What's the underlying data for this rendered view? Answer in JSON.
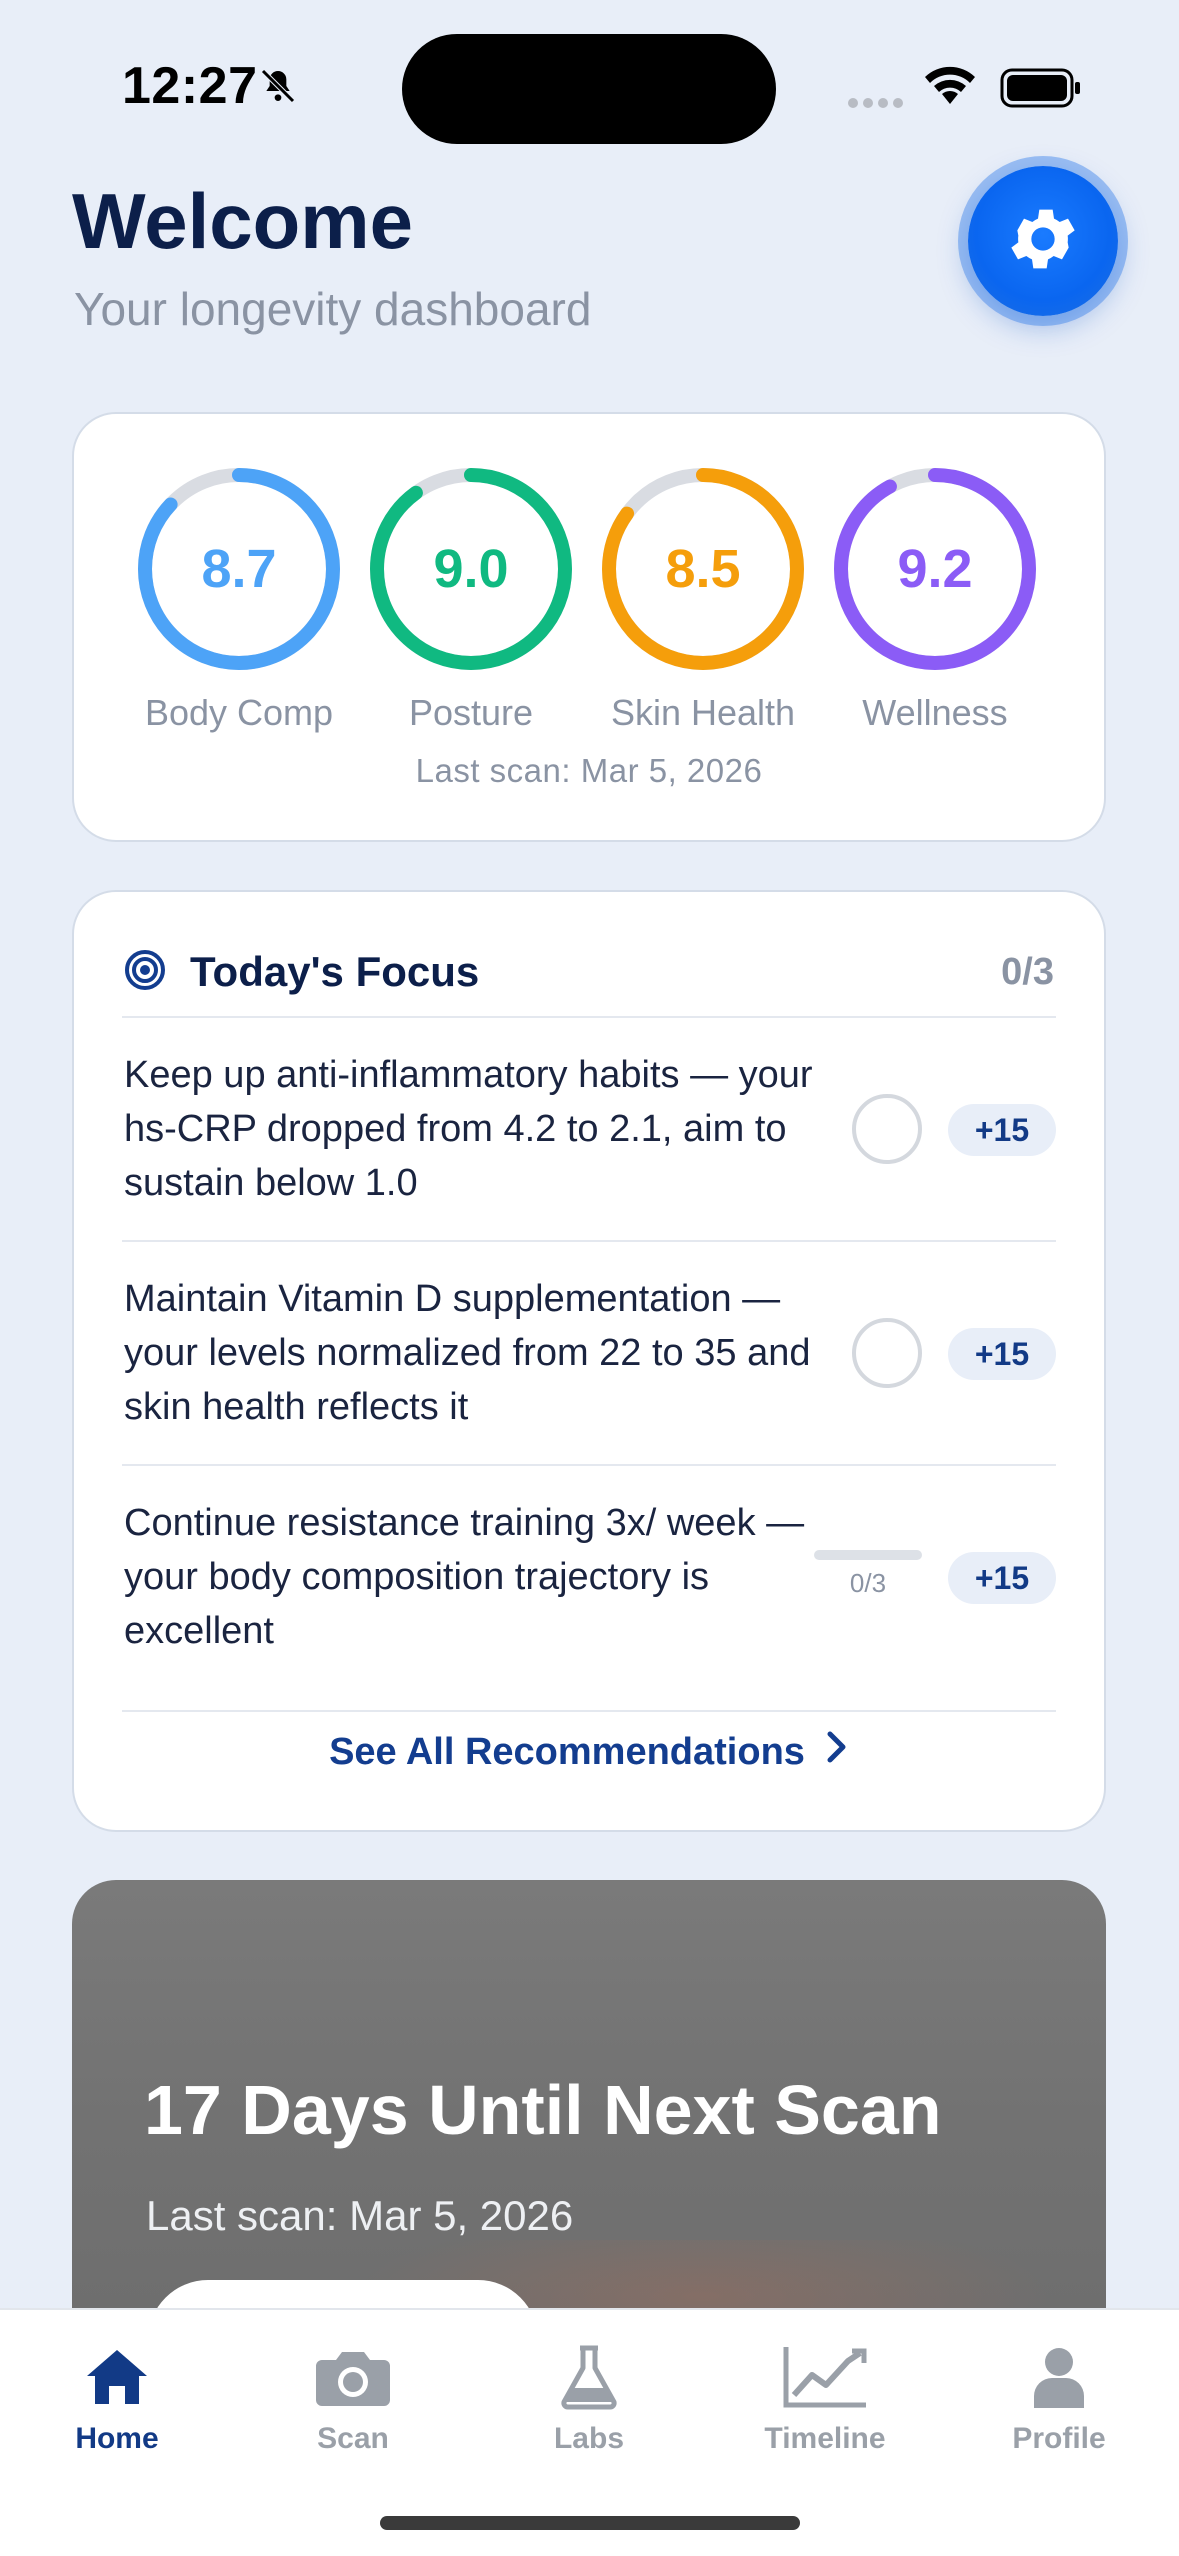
{
  "status_bar": {
    "time": "12:27"
  },
  "header": {
    "title": "Welcome",
    "subtitle": "Your longevity dashboard"
  },
  "scores": {
    "items": [
      {
        "value": "8.7",
        "label": "Body Comp",
        "color": "#4da3f7",
        "fraction": 0.87
      },
      {
        "value": "9.0",
        "label": "Posture",
        "color": "#10b981",
        "fraction": 0.9
      },
      {
        "value": "8.5",
        "label": "Skin Health",
        "color": "#f59e0b",
        "fraction": 0.85
      },
      {
        "value": "9.2",
        "label": "Wellness",
        "color": "#8b5cf6",
        "fraction": 0.92
      }
    ],
    "last_scan": "Last scan: Mar 5, 2026"
  },
  "focus": {
    "title": "Today's Focus",
    "count": "0/3",
    "items": [
      {
        "text": "Keep up anti-inflammatory habits — your hs-CRP dropped from 4.2 to 2.1, aim to sustain below 1.0",
        "points": "+15"
      },
      {
        "text": "Maintain Vitamin D supplementation — your levels normalized from 22 to 35 and skin health reflects it",
        "points": "+15"
      },
      {
        "text": "Continue resistance training 3x/ week — your body composition trajectory is excellent",
        "points": "+15",
        "progress": "0/3",
        "progress_fraction": 0
      }
    ],
    "see_all": "See All Recommendations"
  },
  "scan_banner": {
    "title": "17 Days Until Next Scan",
    "subtitle": "Last scan: Mar 5, 2026"
  },
  "tabs": [
    {
      "label": "Home",
      "icon": "home-icon",
      "active": true
    },
    {
      "label": "Scan",
      "icon": "camera-icon",
      "active": false
    },
    {
      "label": "Labs",
      "icon": "flask-icon",
      "active": false
    },
    {
      "label": "Timeline",
      "icon": "chart-line-icon",
      "active": false
    },
    {
      "label": "Profile",
      "icon": "person-icon",
      "active": false
    }
  ],
  "colors": {
    "accent": "#0a66f0",
    "navy": "#0c1f4a",
    "background": "#e8eef8"
  }
}
